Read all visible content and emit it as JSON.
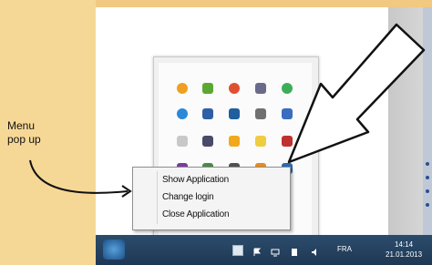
{
  "annotation": {
    "label_line1": "Menu",
    "label_line2": "pop up"
  },
  "context_menu": {
    "items": [
      "Show Application",
      "Change login",
      "Close Application"
    ]
  },
  "taskbar": {
    "language": "FRA",
    "time": "14:14",
    "date": "21.01.2013"
  },
  "zoom_bar": {
    "minus_label": "−",
    "plus_label": "+"
  },
  "tray_icons": [
    {
      "name": "orange-circle-icon",
      "color": "#f0a020"
    },
    {
      "name": "green-leaf-icon",
      "color": "#5aa832"
    },
    {
      "name": "red-circle-icon",
      "color": "#e05030"
    },
    {
      "name": "pin-icon",
      "color": "#6a6a8a"
    },
    {
      "name": "green-refresh-icon",
      "color": "#3cae5a"
    },
    {
      "name": "globe-icon",
      "color": "#2a88d8"
    },
    {
      "name": "blue-window-icon",
      "color": "#2d5fa8"
    },
    {
      "name": "blue-chat-icon",
      "color": "#1f5f9f"
    },
    {
      "name": "gear-icon",
      "color": "#707070"
    },
    {
      "name": "user-icon",
      "color": "#3a6cc0"
    },
    {
      "name": "grey-app-icon",
      "color": "#c8c8c8"
    },
    {
      "name": "monitor-icon",
      "color": "#4a4a6a"
    },
    {
      "name": "orange-box-icon",
      "color": "#f2a81c"
    },
    {
      "name": "yellow-folder-icon",
      "color": "#f0cc40"
    },
    {
      "name": "red-shield-icon",
      "color": "#c03030"
    },
    {
      "name": "onenote-icon",
      "color": "#7a3aa0"
    },
    {
      "name": "app-icon-2",
      "color": "#4a8a4a"
    },
    {
      "name": "network-icon",
      "color": "#505050"
    },
    {
      "name": "orange-app-icon",
      "color": "#e88a20"
    },
    {
      "name": "blue-app-icon",
      "color": "#2a6ab0"
    }
  ]
}
